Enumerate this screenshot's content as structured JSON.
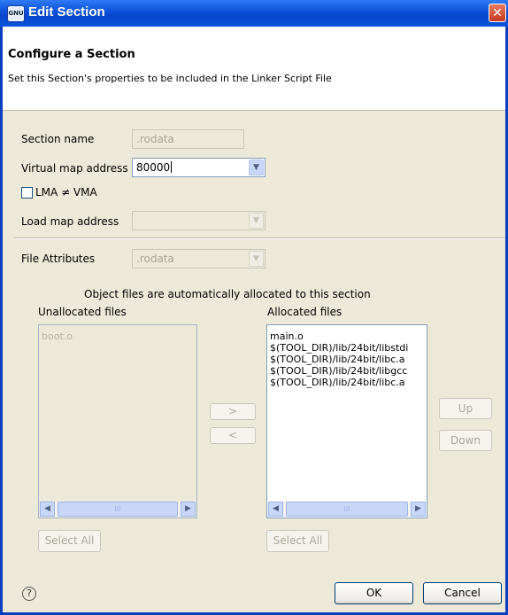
{
  "window": {
    "title": "Edit Section",
    "app_icon_text": "GNU",
    "close_glyph": "✕"
  },
  "header": {
    "title": "Configure a Section",
    "description": "Set this Section's properties to be included in the Linker Script File"
  },
  "form": {
    "section_name_label": "Section name",
    "section_name_value": ".rodata",
    "virtual_map_label": "Virtual map address",
    "virtual_map_value": "80000",
    "lma_checkbox_label": "LMA ≠ VMA",
    "lma_checked": false,
    "load_map_label": "Load map address",
    "load_map_value": "",
    "file_attributes_label": "File Attributes",
    "file_attributes_value": ".rodata"
  },
  "allocation": {
    "info_text": "Object files are automatically allocated to this section",
    "unallocated_label": "Unallocated files",
    "unallocated_files": [
      "boot.o"
    ],
    "allocated_label": "Allocated files",
    "allocated_files": [
      "main.o",
      "$(TOOL_DIR)/lib/24bit/libstdi",
      "$(TOOL_DIR)/lib/24bit/libc.a",
      "$(TOOL_DIR)/lib/24bit/libgcc",
      "$(TOOL_DIR)/lib/24bit/libc.a"
    ],
    "move_right_glyph": ">",
    "move_left_glyph": "<",
    "up_label": "Up",
    "down_label": "Down",
    "select_all_left_label": "Select All",
    "select_all_right_label": "Select All",
    "scroll_left_glyph": "◀",
    "scroll_right_glyph": "▶",
    "thumb_grip_glyph": "III"
  },
  "footer": {
    "help_glyph": "?",
    "ok_label": "OK",
    "cancel_label": "Cancel"
  },
  "icons": {
    "dropdown": "chevron-down-icon",
    "help": "help-icon",
    "close": "close-icon"
  },
  "colors": {
    "titlebar": "#0a4fd8",
    "dialog_bg": "#ece9d8",
    "input_border": "#7f9db9",
    "button_border": "#003c74"
  }
}
